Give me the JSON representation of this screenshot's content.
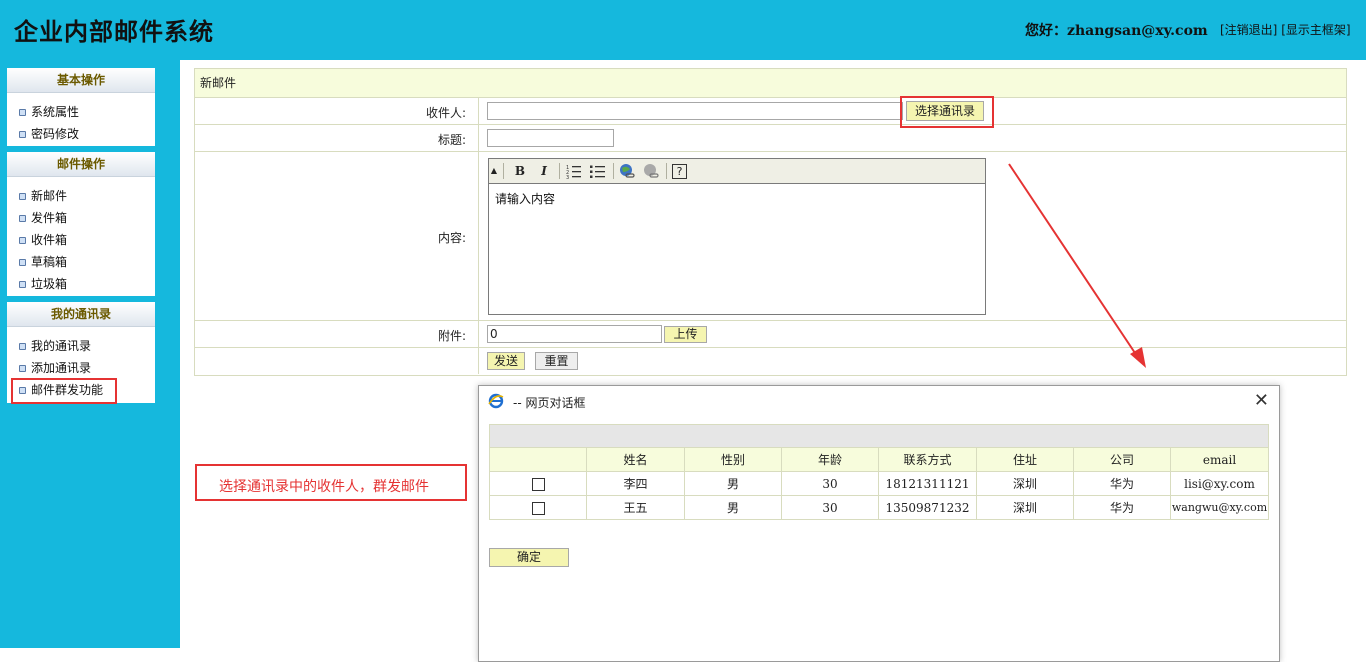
{
  "header": {
    "title": "企业内部邮件系统",
    "greeting": "您好：zhangsan@xy.com",
    "logout_link": "[注销退出]",
    "main_frame_link": "[显示主框架]"
  },
  "sidebar": {
    "basic": {
      "title": "基本操作",
      "items": [
        "系统属性",
        "密码修改"
      ]
    },
    "mail": {
      "title": "邮件操作",
      "items": [
        "新邮件",
        "发件箱",
        "收件箱",
        "草稿箱",
        "垃圾箱"
      ]
    },
    "contacts": {
      "title": "我的通讯录",
      "items": [
        "我的通讯录",
        "添加通讯录",
        "邮件群发功能"
      ]
    }
  },
  "form": {
    "title": "新邮件",
    "recipient_label": "收件人:",
    "recipient_value": "",
    "select_contacts_button": "选择通讯录",
    "subject_label": "标题:",
    "subject_value": "",
    "content_label": "内容:",
    "content_placeholder": "请输入内容",
    "attachment_label": "附件:",
    "attachment_value": "0",
    "upload_button": "上传",
    "send_button": "发送",
    "reset_button": "重置"
  },
  "editor_toolbar": [
    "bold-icon",
    "italic-icon",
    "ordered-list-icon",
    "unordered-list-icon",
    "link-icon",
    "unlink-icon",
    "help-icon"
  ],
  "editor_labels": {
    "bold": "B",
    "italic": "I",
    "help": "?"
  },
  "dialog": {
    "title": "-- 网页对话框",
    "columns": [
      "",
      "姓名",
      "性别",
      "年龄",
      "联系方式",
      "住址",
      "公司",
      "email"
    ],
    "rows": [
      {
        "name": "李四",
        "gender": "男",
        "age": "30",
        "phone": "18121311121",
        "address": "深圳",
        "company": "华为",
        "email": "lisi@xy.com"
      },
      {
        "name": "王五",
        "gender": "男",
        "age": "30",
        "phone": "13509871232",
        "address": "深圳",
        "company": "华为",
        "email": "wangwu@xy.com"
      }
    ],
    "confirm_button": "确定"
  },
  "annotation": {
    "text": "选择通讯录中的收件人，群发邮件"
  },
  "colors": {
    "header_bg": "#15b8dd",
    "highlight": "#e53333",
    "form_header_bg": "#f7fcdc",
    "button_bg": "#f5f5b0"
  }
}
